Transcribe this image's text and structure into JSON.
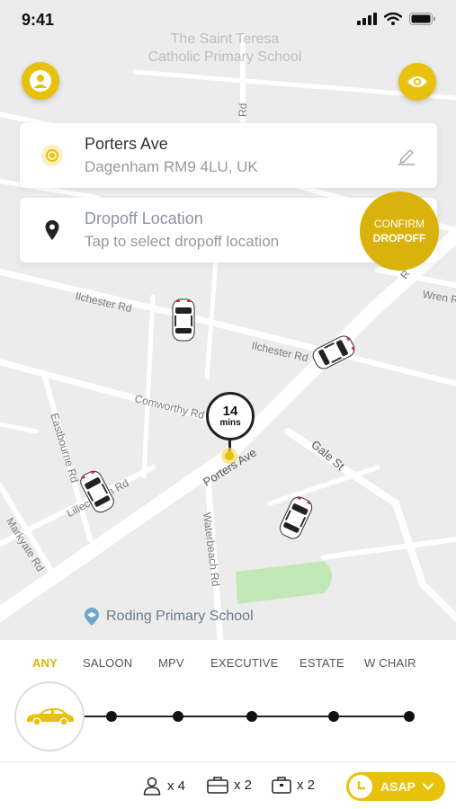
{
  "status": {
    "time": "9:41"
  },
  "map": {
    "poi_top_line1": "The Saint Teresa",
    "poi_top_line2": "Catholic Primary School",
    "poi_bottom": "Roding Primary School",
    "streets": {
      "ilchester_left": "Ilchester Rd",
      "ilchester_right": "Ilchester Rd",
      "wren": "Wren R",
      "comworthy": "Comworthy Rd",
      "porters": "Porters Ave",
      "gale": "Gale St",
      "waterbeach": "Waterbeach Rd",
      "eastbourne": "Eastbourne Rd",
      "lillechurch": "Lillechurch Rd",
      "markyate": "Markyate Rd",
      "top_road": "Rd",
      "right_road": "R"
    },
    "eta": {
      "value": "14",
      "unit": "mins"
    }
  },
  "pickup": {
    "line1": "Porters Ave",
    "line2": "Dagenham RM9 4LU, UK",
    "icon": "pickup-target-icon",
    "edit_icon": "pencil-icon"
  },
  "dropoff": {
    "line1": "Dropoff Location",
    "line2": "Tap to select dropoff location",
    "icon": "map-pin-icon"
  },
  "confirm": {
    "line1": "CONFIRM",
    "line2": "DROPOFF"
  },
  "vehicle_tabs": [
    "ANY",
    "SALOON",
    "MPV",
    "EXECUTIVE",
    "ESTATE",
    "W CHAIR"
  ],
  "selected_tab": "ANY",
  "options": {
    "passengers": "x 4",
    "luggage": "x 2",
    "hand_luggage": "x 2",
    "time_label": "ASAP"
  },
  "colors": {
    "accent": "#e8c10d",
    "accent_dark": "#d9b20c"
  }
}
